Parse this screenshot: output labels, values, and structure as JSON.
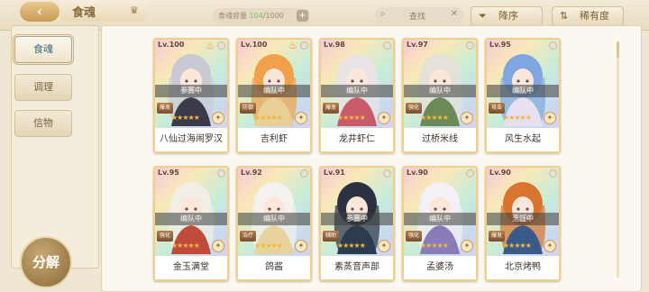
{
  "header": {
    "back_icon": "back-arrow-icon",
    "title": "食魂",
    "capacity_label": "食魂容量",
    "capacity_current": "104",
    "capacity_max": "/1000",
    "search_placeholder": "查找",
    "sort_desc_label": "降序",
    "sort_rarity_label": "稀有度"
  },
  "sidebar": {
    "items": [
      {
        "label": "食魂",
        "active": true
      },
      {
        "label": "调理",
        "active": false
      },
      {
        "label": "信物",
        "active": false
      }
    ],
    "decompose_label": "分解"
  },
  "cards": [
    {
      "level": "Lv.100",
      "status": "参赛中",
      "tag": "爆发",
      "name": "八仙过海闹罗汉",
      "hair": "#c9c9d4",
      "cloth": "#3a3a4a",
      "badge": true
    },
    {
      "level": "Lv.100",
      "status": "编队中",
      "tag": "防御",
      "name": "吉利虾",
      "hair": "#f0a04a",
      "cloth": "#e9cf95",
      "badge": true
    },
    {
      "level": "Lv.98",
      "status": "编队中",
      "tag": "爆发",
      "name": "龙井虾仁",
      "hair": "#e9e3e6",
      "cloth": "#c85a6a",
      "badge": false
    },
    {
      "level": "Lv.97",
      "status": "编队中",
      "tag": "强化",
      "name": "过桥米线",
      "hair": "#e3e1d8",
      "cloth": "#6b8a58",
      "badge": false
    },
    {
      "level": "Lv.95",
      "status": "编队中",
      "tag": "攻击",
      "name": "风生水起",
      "hair": "#7fa6e0",
      "cloth": "#e6e0f0",
      "badge": false
    },
    {
      "level": "Lv.95",
      "status": "编队中",
      "tag": "强化",
      "name": "金玉满堂",
      "hair": "#f1eee6",
      "cloth": "#c24a3a",
      "badge": false
    },
    {
      "level": "Lv.92",
      "status": "编队中",
      "tag": "治疗",
      "name": "鸽酱",
      "hair": "#f4f1ee",
      "cloth": "#e9d39c",
      "badge": false
    },
    {
      "level": "Lv.91",
      "status": "参赛中",
      "tag": "辅助",
      "name": "素蒸音声部",
      "hair": "#2b3140",
      "cloth": "#2d3b4f",
      "badge": false
    },
    {
      "level": "Lv.90",
      "status": "编队中",
      "tag": "强化",
      "name": "孟婆汤",
      "hair": "#f3f0f6",
      "cloth": "#8a7cb8",
      "badge": false
    },
    {
      "level": "Lv.90",
      "status": "烹饪中",
      "tag": "爆发",
      "name": "北京烤鸭",
      "hair": "#d8742f",
      "cloth": "#3a5a8a",
      "badge": false
    }
  ],
  "colors": {
    "accent_gold": "#c99a55",
    "capacity_green": "#7cbc5a",
    "star": "#f2b83a"
  }
}
